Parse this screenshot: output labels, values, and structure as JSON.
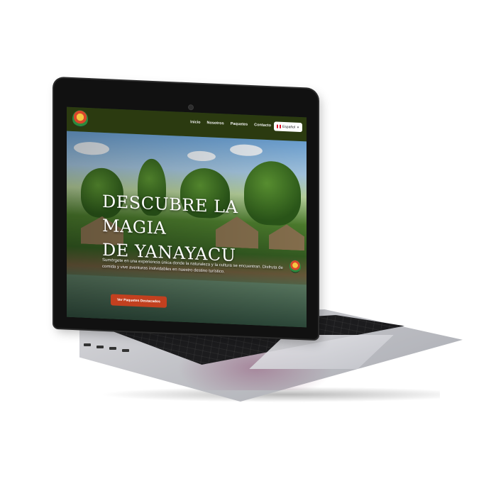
{
  "nav": {
    "links": [
      "Inicio",
      "Nosotros",
      "Paquetes",
      "Contacto"
    ],
    "language": "Español"
  },
  "hero": {
    "title_line1": "DESCUBRE LA MAGIA",
    "title_line2": "DE YANAYACU",
    "subtitle": "Sumérgete en una experiencia única donde la naturaleza y la cultura se encuentran. Disfruta de comida y vive aventuras inolvidables en nuestro destino turístico.",
    "cta_label": "Ver Paquetes Destacados"
  },
  "colors": {
    "nav_bg": "#2b3a10",
    "cta_bg": "#c2401f"
  },
  "icons": {
    "logo": "yanayacu-logo-icon",
    "flag": "peru-flag-icon",
    "dropdown": "chevron-down-icon"
  }
}
